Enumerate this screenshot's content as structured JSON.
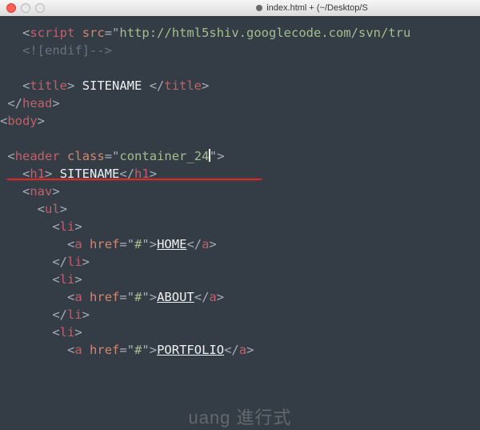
{
  "window": {
    "title": "index.html + (~/Desktop/S"
  },
  "code": {
    "l1_pre": "   ",
    "l1_open": "<",
    "l1_tag": "script",
    "l1_sp": " ",
    "l1_attr": "src",
    "l1_eq": "=",
    "l1_q1": "\"",
    "l1_str": "http://html5shiv.googlecode.com/svn/tru",
    "l2_pre": "   ",
    "l2_cmt": "<![endif]-->",
    "l3_pre": "   ",
    "l3_o": "<",
    "l3_t": "title",
    "l3_c": ">",
    "l3_txt": " SITENAME ",
    "l3_o2": "</",
    "l3_t2": "title",
    "l3_c2": ">",
    "l4_pre": " ",
    "l4_o": "</",
    "l4_t": "head",
    "l4_c": ">",
    "l5_o": "<",
    "l5_t": "body",
    "l5_c": ">",
    "l6_pre": " ",
    "l6_o": "<",
    "l6_t": "header",
    "l6_sp": " ",
    "l6_a": "class",
    "l6_eq": "=",
    "l6_q": "\"",
    "l6_s": "container_24",
    "l6_q2": "\"",
    "l6_c": ">",
    "l7_pre": "   ",
    "l7_o": "<",
    "l7_t": "h1",
    "l7_c": ">",
    "l7_txt": " SITENAME",
    "l7_o2": "</",
    "l7_t2": "h1",
    "l7_c2": ">",
    "l8_pre": "   ",
    "l8_o": "<",
    "l8_t": "nav",
    "l8_c": ">",
    "l9_pre": "     ",
    "l9_o": "<",
    "l9_t": "ul",
    "l9_c": ">",
    "l10_pre": "       ",
    "l10_o": "<",
    "l10_t": "li",
    "l10_c": ">",
    "l11_pre": "         ",
    "l11_o": "<",
    "l11_t": "a",
    "l11_sp": " ",
    "l11_a": "href",
    "l11_eq": "=",
    "l11_q": "\"",
    "l11_s": "#",
    "l11_q2": "\"",
    "l11_c": ">",
    "l11_lnk": "HOME",
    "l11_o2": "</",
    "l11_t2": "a",
    "l11_c2": ">",
    "l12_pre": "       ",
    "l12_o": "</",
    "l12_t": "li",
    "l12_c": ">",
    "l13_pre": "       ",
    "l13_o": "<",
    "l13_t": "li",
    "l13_c": ">",
    "l14_pre": "         ",
    "l14_o": "<",
    "l14_t": "a",
    "l14_sp": " ",
    "l14_a": "href",
    "l14_eq": "=",
    "l14_q": "\"",
    "l14_s": "#",
    "l14_q2": "\"",
    "l14_c": ">",
    "l14_lnk": "ABOUT",
    "l14_o2": "</",
    "l14_t2": "a",
    "l14_c2": ">",
    "l15_pre": "       ",
    "l15_o": "</",
    "l15_t": "li",
    "l15_c": ">",
    "l16_pre": "       ",
    "l16_o": "<",
    "l16_t": "li",
    "l16_c": ">",
    "l17_pre": "         ",
    "l17_o": "<",
    "l17_t": "a",
    "l17_sp": " ",
    "l17_a": "href",
    "l17_eq": "=",
    "l17_q": "\"",
    "l17_s": "#",
    "l17_q2": "\"",
    "l17_c": ">",
    "l17_lnk": "PORTFOLIO",
    "l17_o2": "</",
    "l17_t2": "a",
    "l17_c2": ">"
  },
  "watermark": "uang 進行式"
}
